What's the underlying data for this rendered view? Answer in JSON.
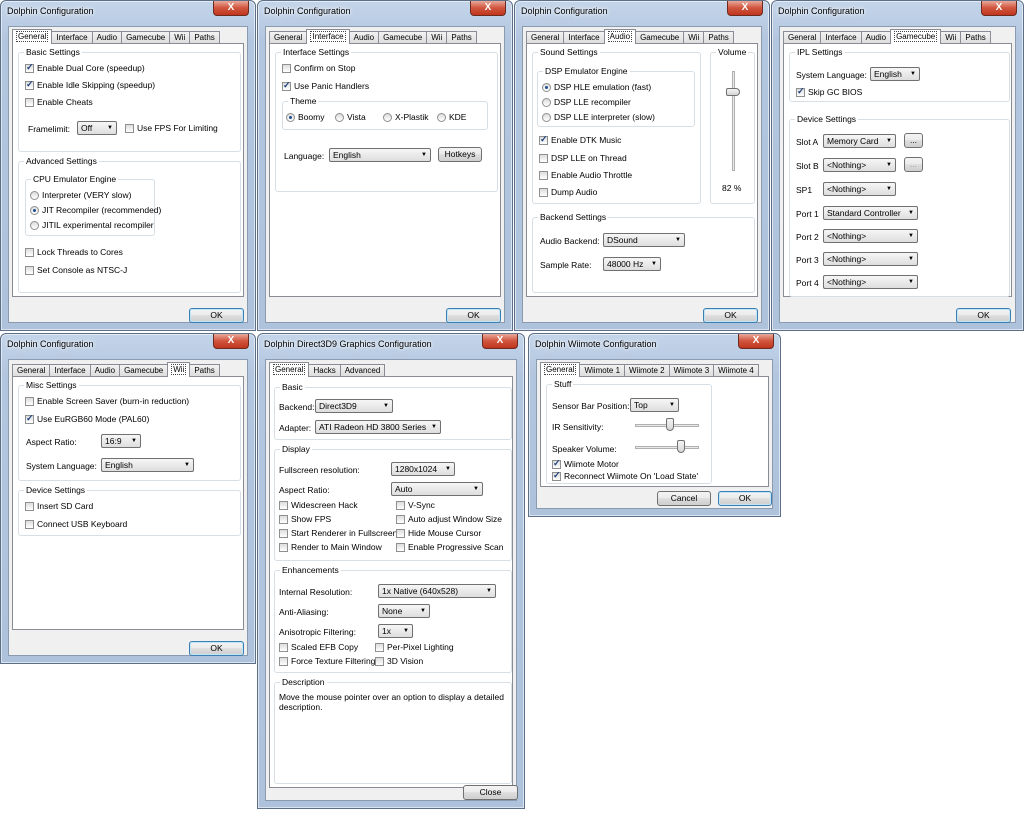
{
  "w1": {
    "title": "Dolphin Configuration",
    "close": "X",
    "tabs": [
      "General",
      "Interface",
      "Audio",
      "Gamecube",
      "Wii",
      "Paths"
    ],
    "basic_legend": "Basic Settings",
    "dual_core": "Enable Dual Core (speedup)",
    "idle_skip": "Enable Idle Skipping (speedup)",
    "cheats": "Enable Cheats",
    "framelimit_label": "Framelimit:",
    "framelimit_value": "Off",
    "use_fps": "Use FPS For Limiting",
    "adv_legend": "Advanced Settings",
    "cpu_legend": "CPU Emulator Engine",
    "interp": "Interpreter (VERY slow)",
    "jit": "JIT Recompiler (recommended)",
    "jitil": "JITIL experimental recompiler",
    "lock_threads": "Lock Threads to Cores",
    "ntscj": "Set Console as NTSC-J",
    "ok": "OK"
  },
  "w2": {
    "title": "Dolphin Configuration",
    "close": "X",
    "tabs": [
      "General",
      "Interface",
      "Audio",
      "Gamecube",
      "Wii",
      "Paths"
    ],
    "legend": "Interface Settings",
    "confirm_stop": "Confirm on Stop",
    "panic": "Use Panic Handlers",
    "theme_legend": "Theme",
    "themes": [
      "Boomy",
      "Vista",
      "X-Plastik",
      "KDE"
    ],
    "language_label": "Language:",
    "language_value": "English",
    "hotkeys": "Hotkeys",
    "ok": "OK"
  },
  "w3": {
    "title": "Dolphin Configuration",
    "close": "X",
    "tabs": [
      "General",
      "Interface",
      "Audio",
      "Gamecube",
      "Wii",
      "Paths"
    ],
    "sound_legend": "Sound Settings",
    "dsp_legend": "DSP Emulator Engine",
    "hle": "DSP HLE emulation (fast)",
    "lle_rec": "DSP LLE recompiler",
    "lle_int": "DSP LLE interpreter (slow)",
    "dtk": "Enable DTK Music",
    "lle_thread": "DSP LLE on Thread",
    "throttle": "Enable Audio Throttle",
    "dump": "Dump Audio",
    "volume_legend": "Volume",
    "volume_value": "82 %",
    "volume_level": 0.82,
    "backend_legend": "Backend Settings",
    "backend_label": "Audio Backend:",
    "backend_value": "DSound",
    "rate_label": "Sample Rate:",
    "rate_value": "48000 Hz",
    "ok": "OK"
  },
  "w4": {
    "title": "Dolphin Configuration",
    "close": "X",
    "tabs": [
      "General",
      "Interface",
      "Audio",
      "Gamecube",
      "Wii",
      "Paths"
    ],
    "ipl_legend": "IPL Settings",
    "sys_lang_label": "System Language:",
    "sys_lang_value": "English",
    "skip_bios": "Skip GC BIOS",
    "dev_legend": "Device Settings",
    "slot_a": "Slot A",
    "slot_a_value": "Memory Card",
    "slot_b": "Slot B",
    "slot_b_value": "<Nothing>",
    "browse": "...",
    "sp1": "SP1",
    "sp1_value": "<Nothing>",
    "port1": "Port 1",
    "port1_value": "Standard Controller",
    "port2": "Port 2",
    "port2_value": "<Nothing>",
    "port3": "Port 3",
    "port3_value": "<Nothing>",
    "port4": "Port 4",
    "port4_value": "<Nothing>",
    "ok": "OK"
  },
  "w5": {
    "title": "Dolphin Configuration",
    "close": "X",
    "tabs": [
      "General",
      "Interface",
      "Audio",
      "Gamecube",
      "Wii",
      "Paths"
    ],
    "misc_legend": "Misc Settings",
    "screensaver": "Enable Screen Saver (burn-in reduction)",
    "eurgb": "Use EuRGB60 Mode (PAL60)",
    "aspect_label": "Aspect Ratio:",
    "aspect_value": "16:9",
    "sys_lang_label": "System Language:",
    "sys_lang_value": "English",
    "dev_legend": "Device Settings",
    "sd": "Insert SD Card",
    "usb_kb": "Connect USB Keyboard",
    "ok": "OK"
  },
  "w6": {
    "title": "Dolphin Direct3D9 Graphics Configuration",
    "close": "X",
    "tabs": [
      "General",
      "Hacks",
      "Advanced"
    ],
    "basic_legend": "Basic",
    "backend_label": "Backend:",
    "backend_value": "Direct3D9",
    "adapter_label": "Adapter:",
    "adapter_value": "ATI Radeon HD 3800 Series",
    "display_legend": "Display",
    "fullres_label": "Fullscreen resolution:",
    "fullres_value": "1280x1024",
    "aspect_label": "Aspect Ratio:",
    "aspect_value": "Auto",
    "widescreen": "Widescreen Hack",
    "vsync": "V-Sync",
    "show_fps": "Show FPS",
    "auto_adjust": "Auto adjust Window Size",
    "start_fullscreen": "Start Renderer in Fullscreen",
    "hide_cursor": "Hide Mouse Cursor",
    "render_main": "Render to Main Window",
    "progressive": "Enable Progressive Scan",
    "enh_legend": "Enhancements",
    "ires_label": "Internal Resolution:",
    "ires_value": "1x Native (640x528)",
    "aa_label": "Anti-Aliasing:",
    "aa_value": "None",
    "aniso_label": "Anisotropic Filtering:",
    "aniso_value": "1x",
    "scaled_efb": "Scaled EFB Copy",
    "ppl": "Per-Pixel Lighting",
    "force_tex": "Force Texture Filtering",
    "vision3d": "3D Vision",
    "desc_legend": "Description",
    "desc_text": "Move the mouse pointer over an option to display a detailed description.",
    "close_btn": "Close"
  },
  "w7": {
    "title": "Dolphin Wiimote Configuration",
    "close": "X",
    "tabs": [
      "General",
      "Wiimote 1",
      "Wiimote 2",
      "Wiimote 3",
      "Wiimote 4"
    ],
    "stuff_legend": "Stuff",
    "sensor_label": "Sensor Bar Position:",
    "sensor_value": "Top",
    "ir_label": "IR Sensitivity:",
    "ir_level": 0.55,
    "speaker_label": "Speaker Volume:",
    "speaker_level": 0.75,
    "motor": "Wiimote Motor",
    "reconnect": "Reconnect Wiimote On 'Load State'",
    "cancel": "Cancel",
    "ok": "OK"
  }
}
